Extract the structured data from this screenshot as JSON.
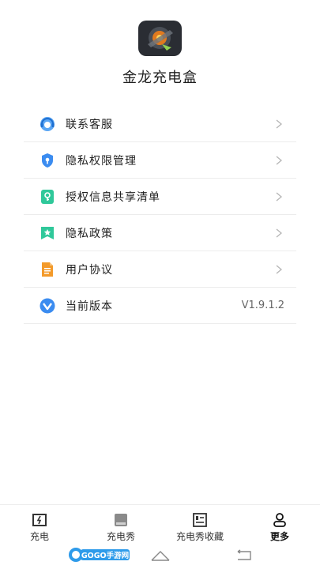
{
  "app": {
    "name": "金龙充电盒"
  },
  "menu": {
    "items": [
      {
        "label": "联系客服",
        "icon": "customer-service-icon"
      },
      {
        "label": "隐私权限管理",
        "icon": "privacy-shield-icon"
      },
      {
        "label": "授权信息共享清单",
        "icon": "authorization-icon"
      },
      {
        "label": "隐私政策",
        "icon": "policy-bookmark-icon"
      },
      {
        "label": "用户协议",
        "icon": "document-icon"
      },
      {
        "label": "当前版本",
        "icon": "version-icon",
        "value": "V1.9.1.2"
      }
    ]
  },
  "tabbar": {
    "tabs": [
      {
        "label": "充电",
        "icon": "charge-icon"
      },
      {
        "label": "充电秀",
        "icon": "charge-show-icon"
      },
      {
        "label": "充电秀收藏",
        "icon": "favorites-icon"
      },
      {
        "label": "更多",
        "icon": "user-icon",
        "active": true
      }
    ]
  },
  "watermark": {
    "text": "GOGO手游网"
  },
  "colors": {
    "accent": "#3b8cf0",
    "green": "#2fc89a",
    "orange": "#f39a2a",
    "divider": "#ececec"
  }
}
